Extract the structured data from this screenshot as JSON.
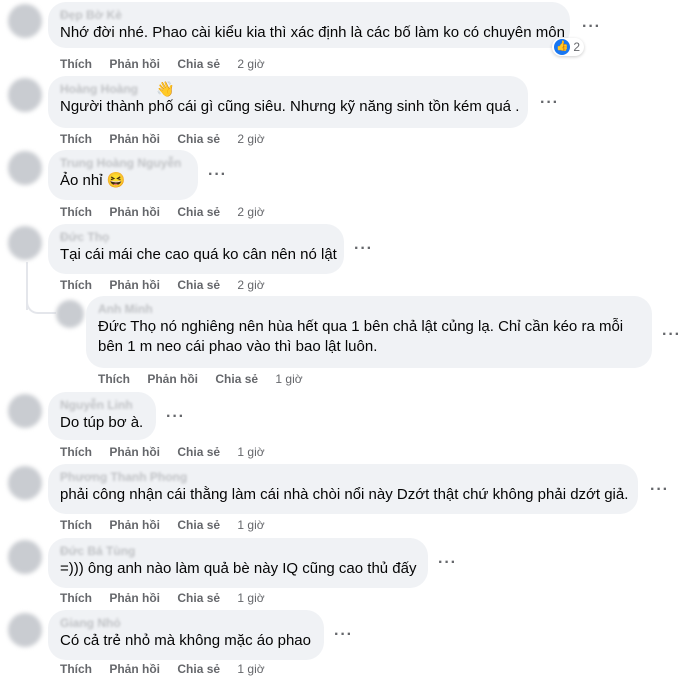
{
  "actions": {
    "like": "Thích",
    "reply": "Phản hồi",
    "share": "Chia sẻ"
  },
  "comments": [
    {
      "author": "Đẹp Bờ Kè",
      "text": "Nhớ đời nhé. Phao cài kiểu kia thì xác định là các bố làm ko có chuyên môn",
      "time": "2 giờ",
      "reactions": "2"
    },
    {
      "author": "Hoàng Hoàng",
      "text": "Người thành phố cái gì cũng siêu. Nhưng kỹ năng sinh tồn kém quá .",
      "time": "2 giờ"
    },
    {
      "author": "Trung Hoàng Nguyễn",
      "text": "Ảo nhỉ 😆",
      "time": "2 giờ"
    },
    {
      "author": "Đức Thọ",
      "text": "Tại cái mái che cao quá ko cân nên nó lật",
      "time": "2 giờ"
    },
    {
      "author": "Anh Minh",
      "text_line1": "Đức Thọ nó nghiêng nên hùa hết qua 1 bên chả lật củng lạ. Chỉ cần kéo ra mỗi",
      "text_line2": "bên 1 m neo cái phao vào thì bao lật luôn.",
      "time": "1 giờ"
    },
    {
      "author": "Nguyễn Linh",
      "text": "Do túp bơ à.",
      "time": "1 giờ"
    },
    {
      "author": "Phương Thanh Phong",
      "text": "phải công nhận cái thằng làm cái nhà chòi nổi này Dzớt thật chứ không phải dzớt giả.",
      "time": "1 giờ"
    },
    {
      "author": "Đức Bá Tùng",
      "text": "=))) ông anh nào làm quả bè này IQ cũng cao thủ đấy",
      "time": "1 giờ"
    },
    {
      "author": "Giang Nhỏ",
      "text": "Có cả trẻ nhỏ mà không mặc áo phao",
      "time": "1 giờ"
    }
  ],
  "icons": {
    "more": "more-options-icon",
    "like": "like-reaction-icon",
    "wave": "wave-icon"
  },
  "colors": {
    "bubble": "#f0f2f5",
    "meta": "#65676b",
    "like": "#1877f2"
  }
}
